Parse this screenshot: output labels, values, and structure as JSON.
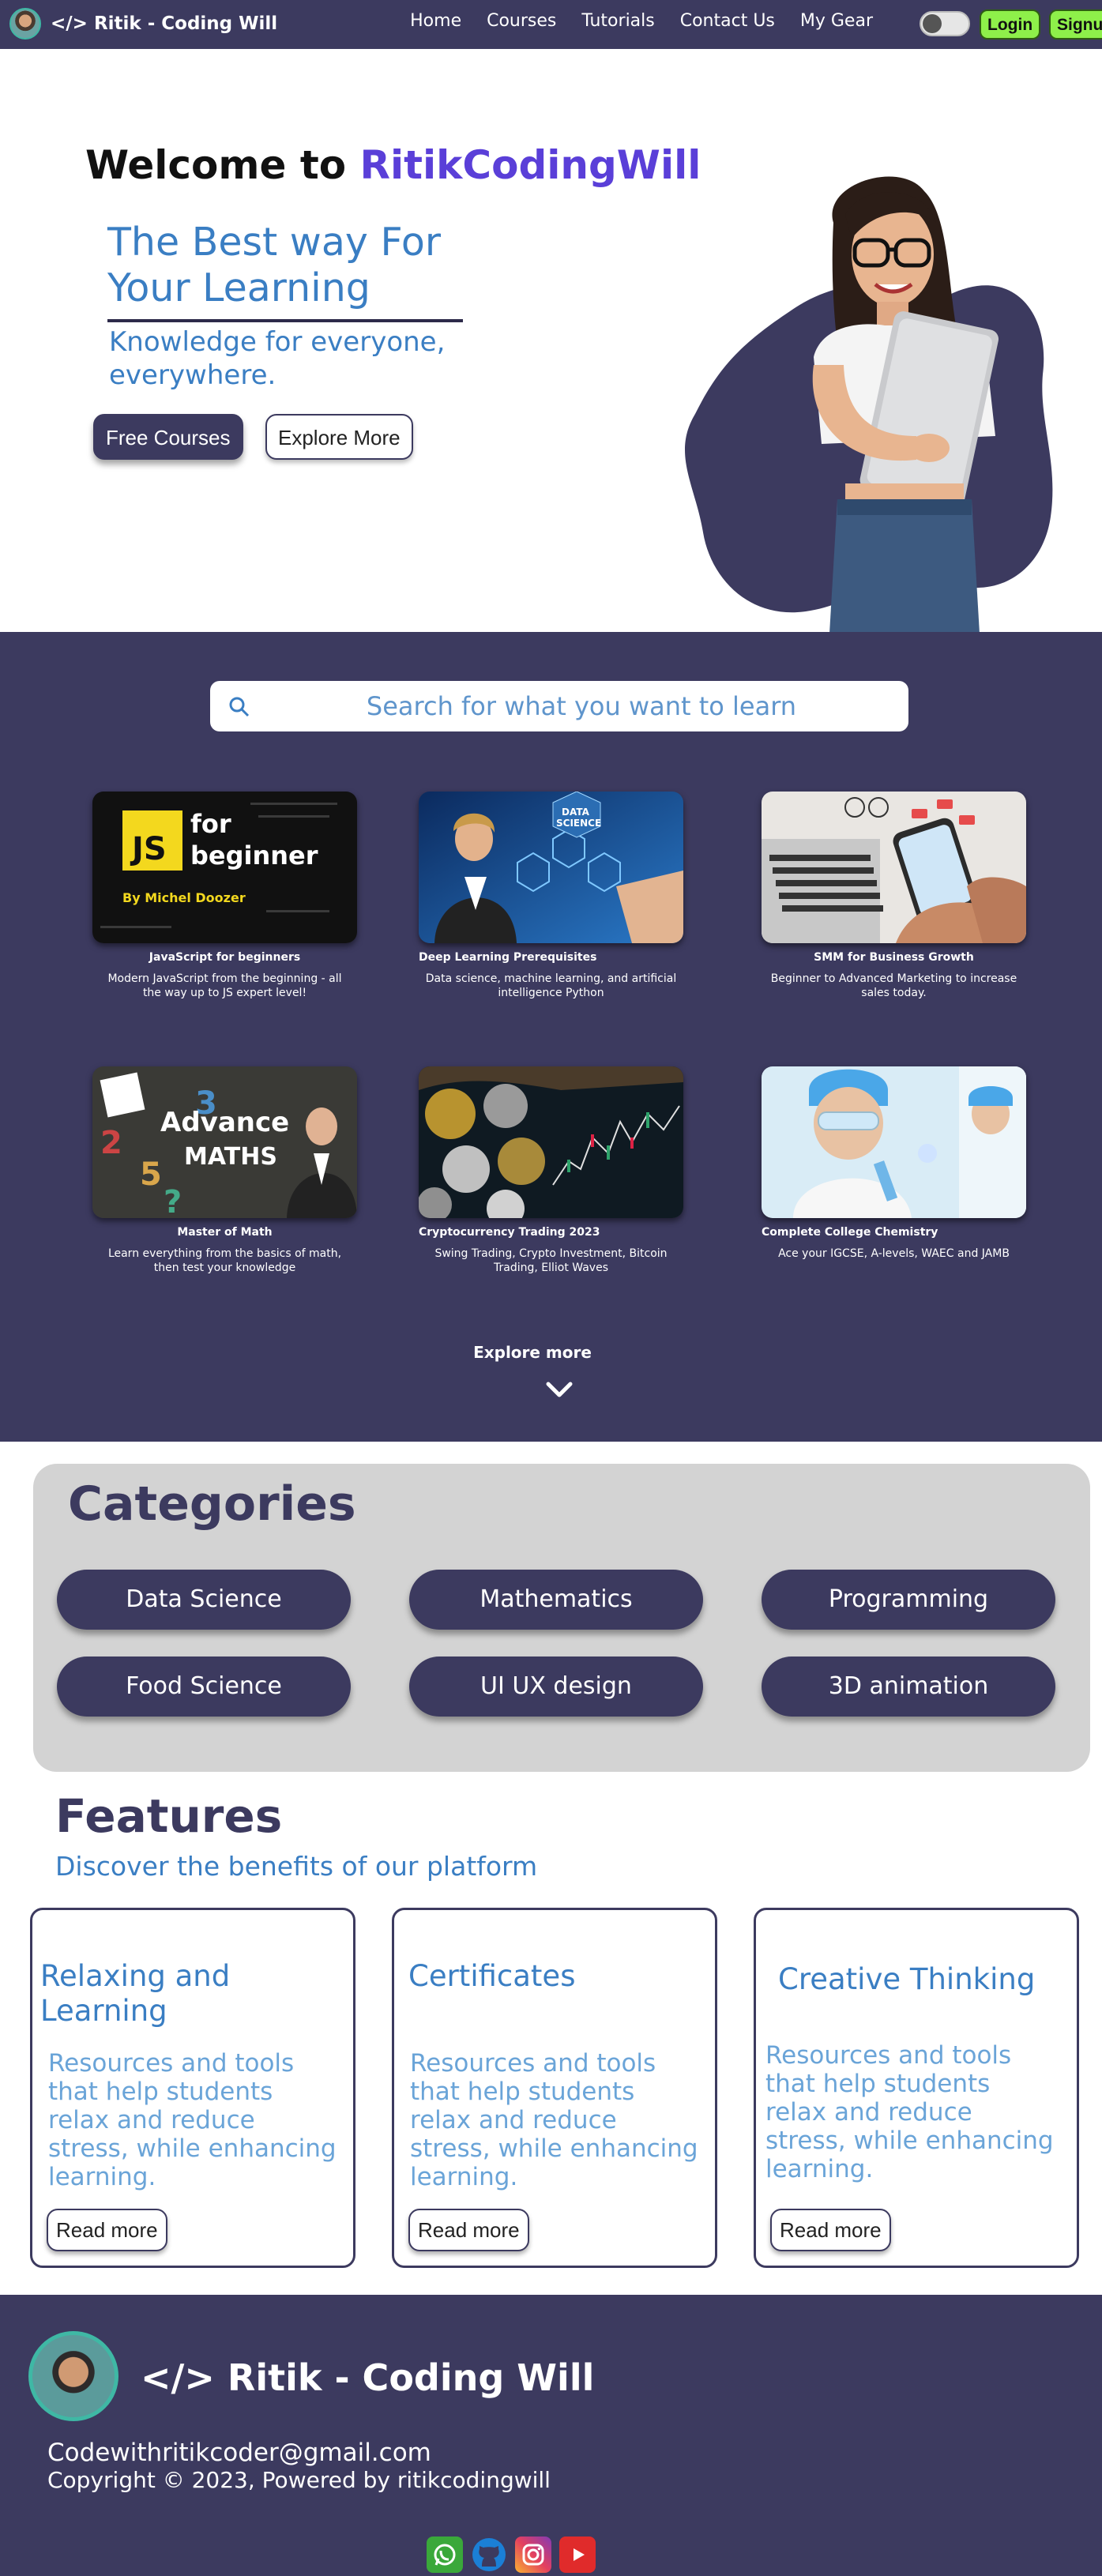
{
  "nav": {
    "brand": "</> Ritik - Coding Will",
    "links": [
      "Home",
      "Courses",
      "Tutorials",
      "Contact Us",
      "My Gear"
    ],
    "login": "Login",
    "signup": "Signup"
  },
  "hero": {
    "welcome_prefix": "Welcome to ",
    "welcome_accent": "RitikCodingWill",
    "tagline": "The Best way For Your Learning",
    "subtitle": "Knowledge for everyone, everywhere.",
    "primary_button": "Free Courses",
    "secondary_button": "Explore More"
  },
  "search": {
    "placeholder": "Search for what you want to learn"
  },
  "courses": [
    {
      "title": "JavaScript for beginners",
      "desc": "Modern JavaScript from the beginning - all the way up to JS expert level!",
      "thumb_text": [
        "JS",
        "for",
        "beginner",
        "By Michel Doozer"
      ]
    },
    {
      "title": "Deep Learning Prerequisites",
      "desc": "Data science, machine learning, and artificial intelligence Python",
      "thumb_text": [
        "DATA",
        "SCIENCE"
      ]
    },
    {
      "title": "SMM for Business Growth",
      "desc": "Beginner to Advanced  Marketing to increase sales today.",
      "thumb_text": []
    },
    {
      "title": "Master of Math",
      "desc": "Learn everything from the basics of math, then test your knowledge",
      "thumb_text": [
        "Advance",
        "MATHS"
      ]
    },
    {
      "title": "Cryptocurrency Trading 2023",
      "desc": "Swing Trading, Crypto Investment, Bitcoin Trading, Elliot Waves",
      "thumb_text": []
    },
    {
      "title": "Complete College Chemistry",
      "desc": "Ace your IGCSE, A-levels, WAEC and JAMB",
      "thumb_text": []
    }
  ],
  "explore_more": "Explore more",
  "categories": {
    "title": "Categories",
    "items": [
      "Data Science",
      "Mathematics",
      "Programming",
      "Food Science",
      "UI UX design",
      "3D animation"
    ]
  },
  "features": {
    "title": "Features",
    "subtitle": "Discover the benefits of our platform",
    "items": [
      {
        "title": "Relaxing and Learning",
        "desc": "Resources and tools that help students relax and reduce stress, while enhancing learning.",
        "button": "Read more"
      },
      {
        "title": "Certificates",
        "desc": "Resources and tools that help students relax and reduce stress, while enhancing learning.",
        "button": "Read more"
      },
      {
        "title": "Creative Thinking",
        "desc": "Resources and tools that help students relax and reduce stress, while enhancing learning.",
        "button": "Read more"
      }
    ]
  },
  "footer": {
    "brand": "</> Ritik - Coding Will",
    "email": "Codewithritikcoder@gmail.com",
    "copyright": "Copyright © 2023, Powered by ritikcodingwill",
    "socials": [
      "whatsapp-icon",
      "github-icon",
      "instagram-icon",
      "youtube-icon"
    ]
  },
  "colors": {
    "navy": "#3c3a5f",
    "accent_blue": "#3a7ec3",
    "accent_purple": "#5a3fd8",
    "button_green": "#8ef04a"
  }
}
